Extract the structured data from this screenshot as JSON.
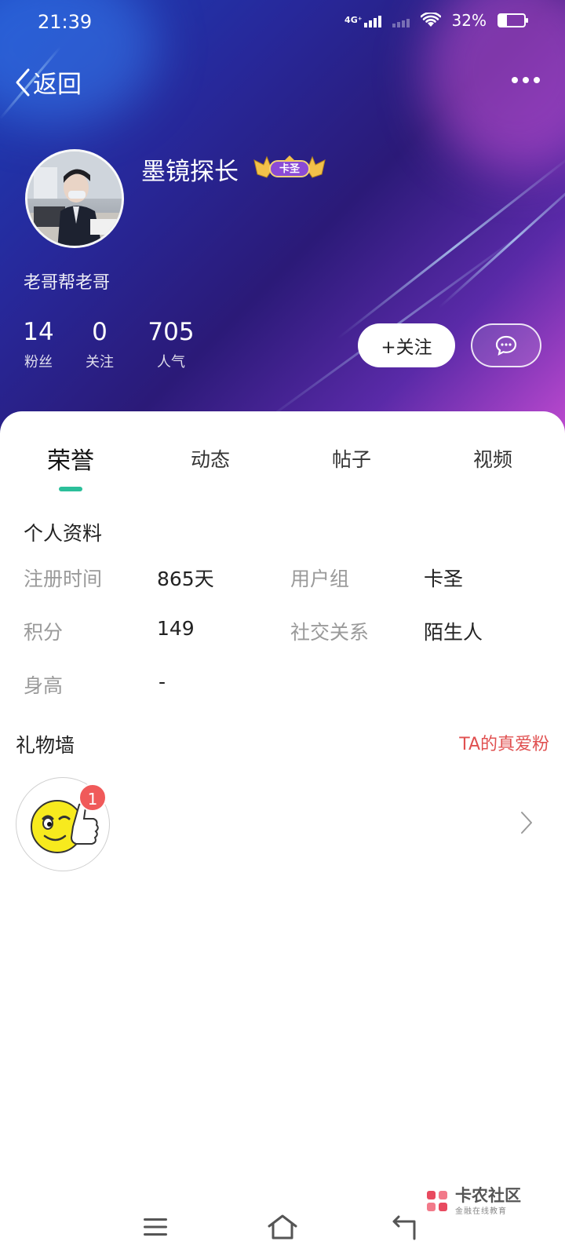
{
  "status_bar": {
    "time": "21:39",
    "network": "4G⁺",
    "battery_percent": "32%",
    "battery_level": 0.32
  },
  "header": {
    "back_label": "返回",
    "more_icon": "more-dots-icon"
  },
  "profile": {
    "nickname": "墨镜探长",
    "badge": "卡圣",
    "signature": "老哥帮老哥",
    "stats": [
      {
        "value": "14",
        "label": "粉丝"
      },
      {
        "value": "0",
        "label": "关注"
      },
      {
        "value": "705",
        "label": "人气"
      }
    ],
    "follow_label": "+关注",
    "message_icon": "chat-bubble-icon"
  },
  "tabs": [
    {
      "label": "荣誉",
      "active": true
    },
    {
      "label": "动态",
      "active": false
    },
    {
      "label": "帖子",
      "active": false
    },
    {
      "label": "视频",
      "active": false
    }
  ],
  "personal_info": {
    "title": "个人资料",
    "rows": [
      {
        "label": "注册时间",
        "value": "865天"
      },
      {
        "label": "用户组",
        "value": "卡圣"
      },
      {
        "label": "积分",
        "value": "149"
      },
      {
        "label": "社交关系",
        "value": "陌生人"
      },
      {
        "label": "身高",
        "value": "-"
      }
    ]
  },
  "gift_wall": {
    "title": "礼物墙",
    "fans_link": "TA的真爱粉",
    "gift_count": "1",
    "gift_icon": "thumbs-up-emoji-icon"
  },
  "watermark": {
    "title": "卡农社区",
    "subtitle": "金融在线教育"
  },
  "colors": {
    "accent": "#2bbf9a",
    "link_red": "#e05050",
    "badge_red": "#f05a5a"
  }
}
